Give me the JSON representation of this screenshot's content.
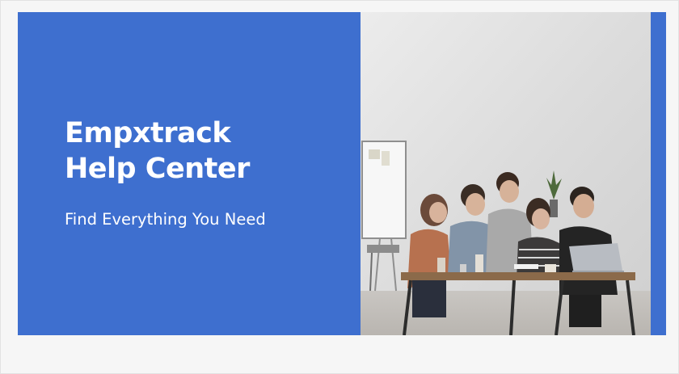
{
  "banner": {
    "title_line1": "Empxtrack",
    "title_line2": "Help Center",
    "subtitle": "Find Everything You Need",
    "background_color": "#3e6fcf"
  },
  "photo": {
    "subject": "team-meeting-photo"
  }
}
